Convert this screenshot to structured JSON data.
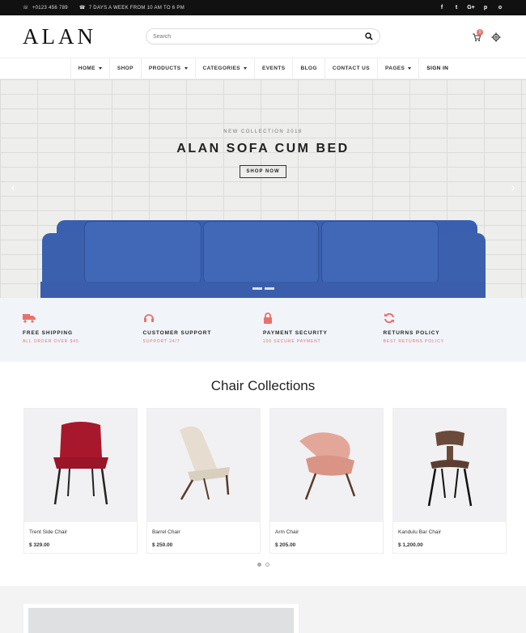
{
  "topbar": {
    "phone": "+0123 456 789",
    "hours": "7 DAYS A WEEK FROM 10 AM TO 6 PM",
    "social": [
      "f",
      "t",
      "G+",
      "p",
      "o"
    ]
  },
  "header": {
    "logo": "ALAN",
    "search_placeholder": "Search",
    "cart_count": "0"
  },
  "nav": {
    "items": [
      {
        "label": "HOME"
      },
      {
        "label": "SHOP"
      },
      {
        "label": "PRODUCTS"
      },
      {
        "label": "CATEGORIES"
      },
      {
        "label": "EVENTS"
      },
      {
        "label": "BLOG"
      },
      {
        "label": "CONTACT US"
      },
      {
        "label": "PAGES"
      },
      {
        "label": "SIGN IN"
      }
    ]
  },
  "hero": {
    "kicker": "NEW COLLECTION 2018",
    "title": "ALAN SOFA CUM BED",
    "cta": "SHOP NOW"
  },
  "features": [
    {
      "title": "FREE SHIPPING",
      "subtitle": "ALL ORDER OVER $45",
      "icon": "truck-icon"
    },
    {
      "title": "CUSTOMER SUPPORT",
      "subtitle": "SUPPORT 24/7",
      "icon": "headset-icon"
    },
    {
      "title": "PAYMENT SECURITY",
      "subtitle": "100 SECURE PAYMENT",
      "icon": "lock-icon"
    },
    {
      "title": "RETURNS POLICY",
      "subtitle": "BEST RETURNS POLICY",
      "icon": "refresh-icon"
    }
  ],
  "collections": {
    "title": "Chair Collections",
    "products": [
      {
        "name": "Trent Side Chair",
        "price": "$ 329.00"
      },
      {
        "name": "Barrel Chair",
        "price": "$ 250.00"
      },
      {
        "name": "Arm Chair",
        "price": "$ 205.00"
      },
      {
        "name": "Kandulu Bar Chair",
        "price": "$ 1,200.00"
      }
    ]
  },
  "colors": {
    "accent": "#e8726a",
    "topbar": "#111111",
    "features_bg": "#f1f4f9"
  }
}
